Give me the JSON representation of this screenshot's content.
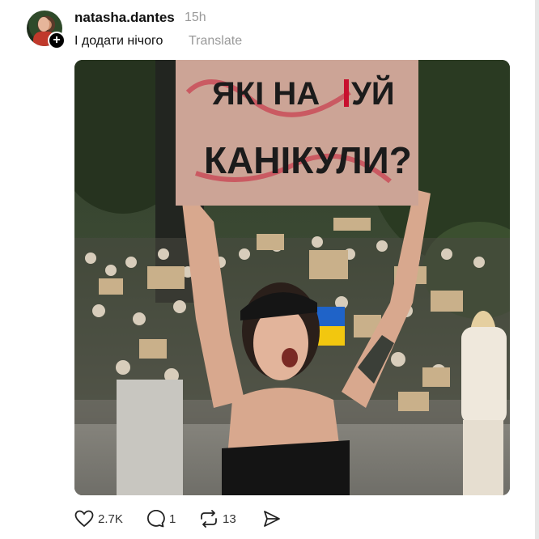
{
  "post": {
    "username": "natasha.dantes",
    "time": "15h",
    "caption": "І додати нічого",
    "translate_label": "Translate",
    "image": {
      "sign_line1": "ЯКІ НА",
      "sign_line1_end": "УЙ",
      "sign_line2": "КАНІКУЛИ?"
    }
  },
  "actions": {
    "likes": "2.7K",
    "replies": "1",
    "reposts": "13"
  },
  "icons": {
    "like": "heart-icon",
    "reply": "comment-icon",
    "repost": "repost-icon",
    "share": "send-icon",
    "follow": "plus-icon"
  },
  "colors": {
    "text": "#101010",
    "muted": "#999999",
    "sign_red": "#c8102e"
  }
}
